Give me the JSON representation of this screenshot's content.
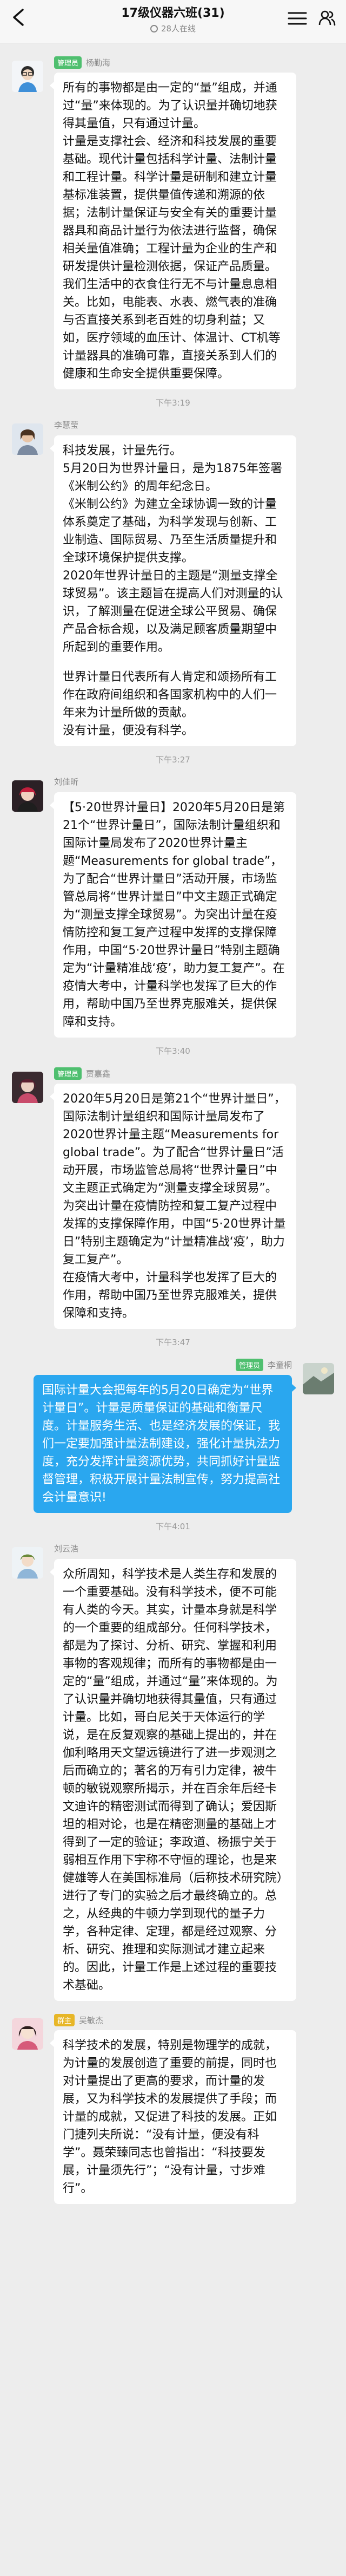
{
  "nav": {
    "title": "17级仪器六班(31)",
    "subtitle": "28人在线"
  },
  "messages": [
    {
      "role": "管理员",
      "name": "杨勤海",
      "paragraphs": [
        "所有的事物都是由一定的“量”组成，并通过“量”来体现的。为了认识量并确切地获得其量值，只有通过计量。",
        "计量是支撑社会、经济和科技发展的重要基础。现代计量包括科学计量、法制计量和工程计量。科学计量是研制和建立计量基标准装置，提供量值传递和溯源的依据；法制计量保证与安全有关的重要计量器具和商品计量行为依法进行监督，确保相关量值准确；工程计量为企业的生产和研发提供计量检测依据，保证产品质量。我们生活中的衣食住行无不与计量息息相关。比如，电能表、水表、燃气表的准确与否直接关系到老百姓的切身利益；又如，医疗领域的血压计、体温计、CT机等计量器具的准确可靠，直接关系到人们的健康和生命安全提供重要保障。"
      ],
      "time": "下午3:19"
    },
    {
      "role": "",
      "name": "李慧莹",
      "paragraphs": [
        "科技发展，计量先行。",
        "5月20日为世界计量日，是为1875年签署《米制公约》的周年纪念日。",
        "《米制公约》为建立全球协调一致的计量体系奠定了基础，为科学发现与创新、工业制造、国际贸易、乃至生活质量提升和全球环境保护提供支撑。",
        "2020年世界计量日的主题是“测量支撑全球贸易”。该主题旨在提高人们对测量的认识，了解测量在促进全球公平贸易、确保产品合标合规，以及满足顾客质量期望中所起到的重要作用。",
        "",
        "世界计量日代表所有人肯定和颂扬所有工作在政府间组织和各国家机构中的人们一年来为计量所做的贡献。",
        "没有计量，便没有科学。"
      ],
      "time": "下午3:27"
    },
    {
      "role": "",
      "name": "刘佳昕",
      "paragraphs": [
        "【5·20世界计量日】2020年5月20日是第21个“世界计量日”，国际法制计量组织和国际计量局发布了2020世界计量主题“Measurements for global trade”，为了配合“世界计量日”活动开展，市场监管总局将“世界计量日”中文主题正式确定为“测量支撑全球贸易”。为突出计量在疫情防控和复工复产过程中发挥的支撑保障作用，中国“5·20世界计量日”特别主题确定为“计量精准战‘疫’，助力复工复产”。在疫情大考中，计量科学也发挥了巨大的作用，帮助中国乃至世界克服难关，提供保障和支持。"
      ],
      "time": "下午3:40"
    },
    {
      "role": "管理员",
      "name": "贾嘉鑫",
      "paragraphs": [
        "2020年5月20日是第21个“世界计量日”，国际法制计量组织和国际计量局发布了2020世界计量主题“Measurements for global trade”。为了配合“世界计量日”活动开展，市场监管总局将“世界计量日”中文主题正式确定为“测量支撑全球贸易”。为突出计量在疫情防控和复工复产过程中发挥的支撑保障作用，中国“5·20世界计量日”特别主题确定为“计量精准战‘疫’，助力复工复产”。",
        "在疫情大考中，计量科学也发挥了巨大的作用，帮助中国乃至世界克服难关，提供保障和支持。"
      ],
      "time": "下午3:47"
    },
    {
      "role": "管理员",
      "name": "李童桐",
      "mine": true,
      "paragraphs": [
        "国际计量大会把每年的5月20日确定为“世界计量日”。计量是质量保证的基础和衡量尺度。计量服务生活、也是经济发展的保证，我们一定要加强计量法制建设，强化计量执法力度，充分发挥计量资源优势，共同抓好计量监督管理，积极开展计量法制宣传，努力提高社会计量意识!"
      ],
      "time": "下午4:01"
    },
    {
      "role": "",
      "name": "刘云浩",
      "paragraphs": [
        "众所周知，科学技术是人类生存和发展的一个重要基础。没有科学技术，便不可能有人类的今天。其实，计量本身就是科学的一个重要的组成部分。任何科学技术，都是为了探讨、分析、研究、掌握和利用事物的客观规律；而所有的事物都是由一定的“量”组成，并通过“量”来体现的。为了认识量并确切地获得其量值，只有通过计量。比如，哥白尼关于天体运行的学说，是在反复观察的基础上提出的，并在伽利略用天文望远镜进行了进一步观测之后而确立的；著名的万有引力定律，被牛顿的敏锐观察所揭示，并在百余年后经卡文迪许的精密测试而得到了确认；爱因斯坦的相对论，也是在精密测量的基础上才得到了一定的验证；李政道、杨振宁关于弱相互作用下宇称不守恒的理论，也是来健雄等人在美国标准局（后称技术研究院）进行了专门的实验之后才最终确立的。总之，从经典的牛顿力学到现代的量子力学，各种定律、定理，都是经过观察、分析、研究、推理和实际测试才建立起来的。因此，计量工作是上述过程的重要技术基础。"
      ],
      "time": ""
    },
    {
      "role": "群主",
      "name": "吴敏杰",
      "roleGold": true,
      "paragraphs": [
        "科学技术的发展，特别是物理学的成就，为计量的发展创造了重要的前提，同时也对计量提出了更高的要求，而计量的发展，又为科学技术的发展提供了手段；而计量的成就，又促进了科技的发展。正如门捷列夫所说：“没有计量，便没有科学”。聂荣臻同志也曾指出：“科技要发展，计量须先行”；“没有计量，寸步难行”。"
      ],
      "time": ""
    }
  ]
}
